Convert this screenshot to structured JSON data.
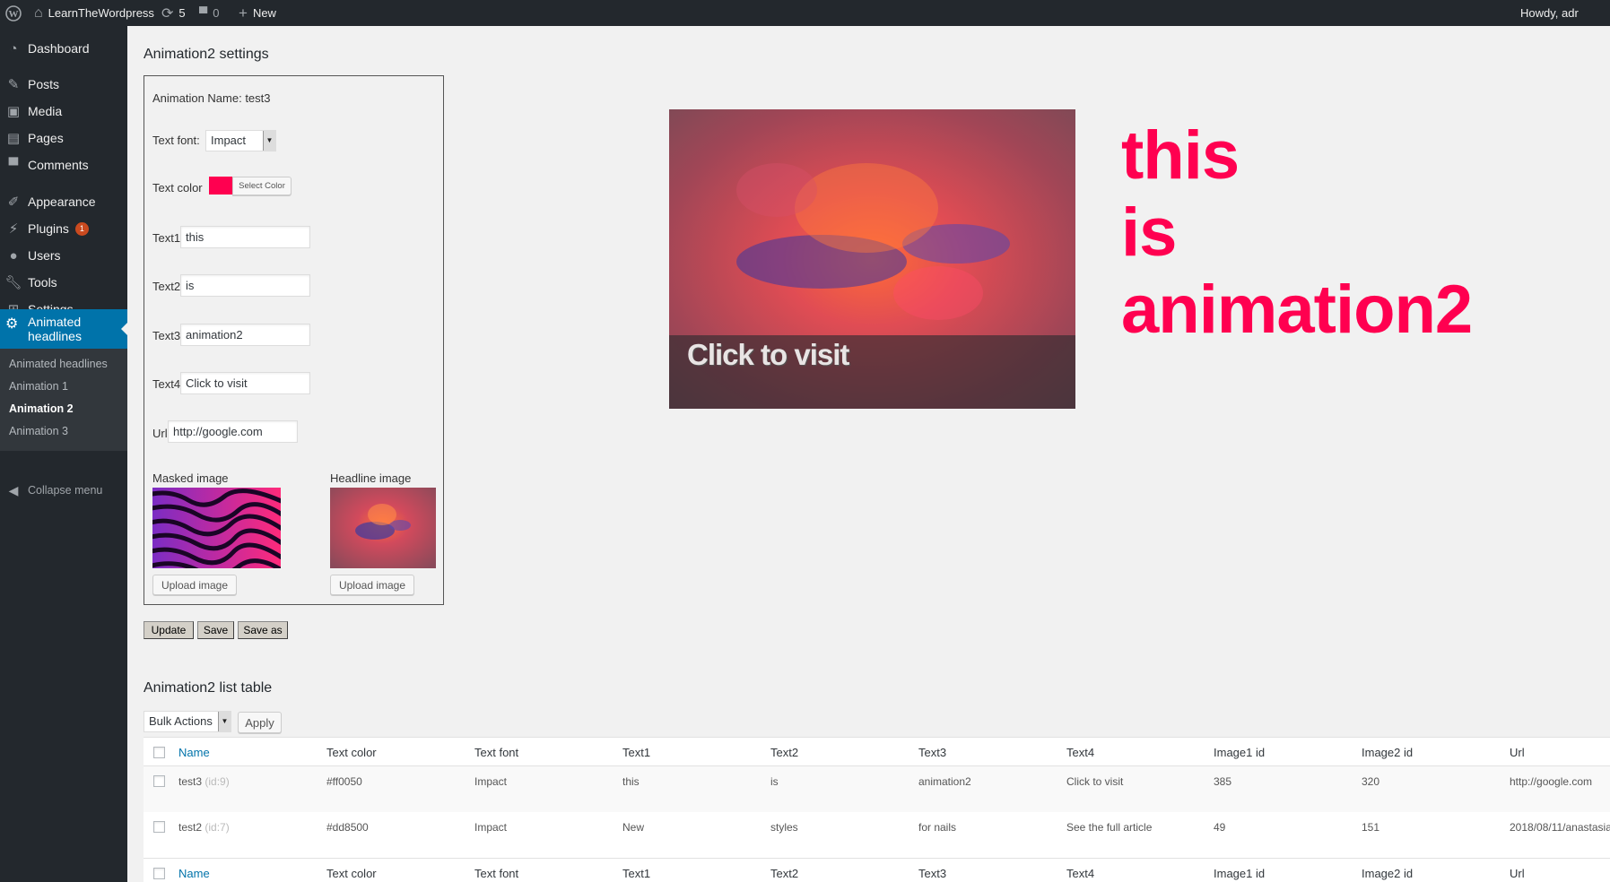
{
  "admin_bar": {
    "site_name": "LearnTheWordpress",
    "updates_count": "5",
    "comments_count": "0",
    "new_label": "New",
    "howdy": "Howdy, adr"
  },
  "sidebar": {
    "items": [
      {
        "label": "Dashboard",
        "icon": "dashboard-icon"
      },
      {
        "label": "Posts",
        "icon": "pin-icon"
      },
      {
        "label": "Media",
        "icon": "media-icon"
      },
      {
        "label": "Pages",
        "icon": "pages-icon"
      },
      {
        "label": "Comments",
        "icon": "comments-icon"
      },
      {
        "label": "Appearance",
        "icon": "brush-icon"
      },
      {
        "label": "Plugins",
        "icon": "plugin-icon",
        "badge": "1"
      },
      {
        "label": "Users",
        "icon": "users-icon"
      },
      {
        "label": "Tools",
        "icon": "wrench-icon"
      },
      {
        "label": "Settings",
        "icon": "settings-icon"
      }
    ],
    "current": {
      "label_line1": "Animated",
      "label_line2": "headlines",
      "icon": "gear-icon"
    },
    "submenu": [
      "Animated headlines",
      "Animation 1",
      "Animation 2",
      "Animation 3"
    ],
    "submenu_current": "Animation 2",
    "collapse_label": "Collapse menu"
  },
  "settings": {
    "title": "Animation2 settings",
    "animation_name": "Animation Name: test3",
    "text_font_label": "Text font:",
    "text_font_value": "Impact",
    "text_color_label": "Text color",
    "text_color_value": "#ff0050",
    "select_color_label": "Select Color",
    "text1_label": "Text1",
    "text1_value": "this",
    "text2_label": "Text2",
    "text2_value": "is",
    "text3_label": "Text3",
    "text3_value": "animation2",
    "text4_label": "Text4",
    "text4_value": "Click to visit",
    "url_label": "Url",
    "url_value": "http://google.com",
    "masked_image_label": "Masked image",
    "headline_image_label": "Headline image",
    "upload_label": "Upload image",
    "update_label": "Update",
    "save_label": "Save",
    "save_as_label": "Save as"
  },
  "preview": {
    "overlay_text": "Click to visit",
    "lines": [
      "this",
      "is",
      "animation2"
    ],
    "text_color": "#ff0050"
  },
  "list": {
    "title": "Animation2 list table",
    "bulk_actions": "Bulk Actions",
    "apply_label": "Apply",
    "columns": [
      "Name",
      "Text color",
      "Text font",
      "Text1",
      "Text2",
      "Text3",
      "Text4",
      "Image1 id",
      "Image2 id",
      "Url"
    ],
    "rows": [
      {
        "name": "test3",
        "id": "(id:9)",
        "color": "#ff0050",
        "font": "Impact",
        "text1": "this",
        "text2": "is",
        "text3": "animation2",
        "text4": "Click to visit",
        "img1": "385",
        "img2": "320",
        "url": "http://google.com"
      },
      {
        "name": "test2",
        "id": "(id:7)",
        "color": "#dd8500",
        "font": "Impact",
        "text1": "New",
        "text2": "styles",
        "text3": "for nails",
        "text4": "See the full article",
        "img1": "49",
        "img2": "151",
        "url": "2018/08/11/anastasia"
      }
    ]
  }
}
